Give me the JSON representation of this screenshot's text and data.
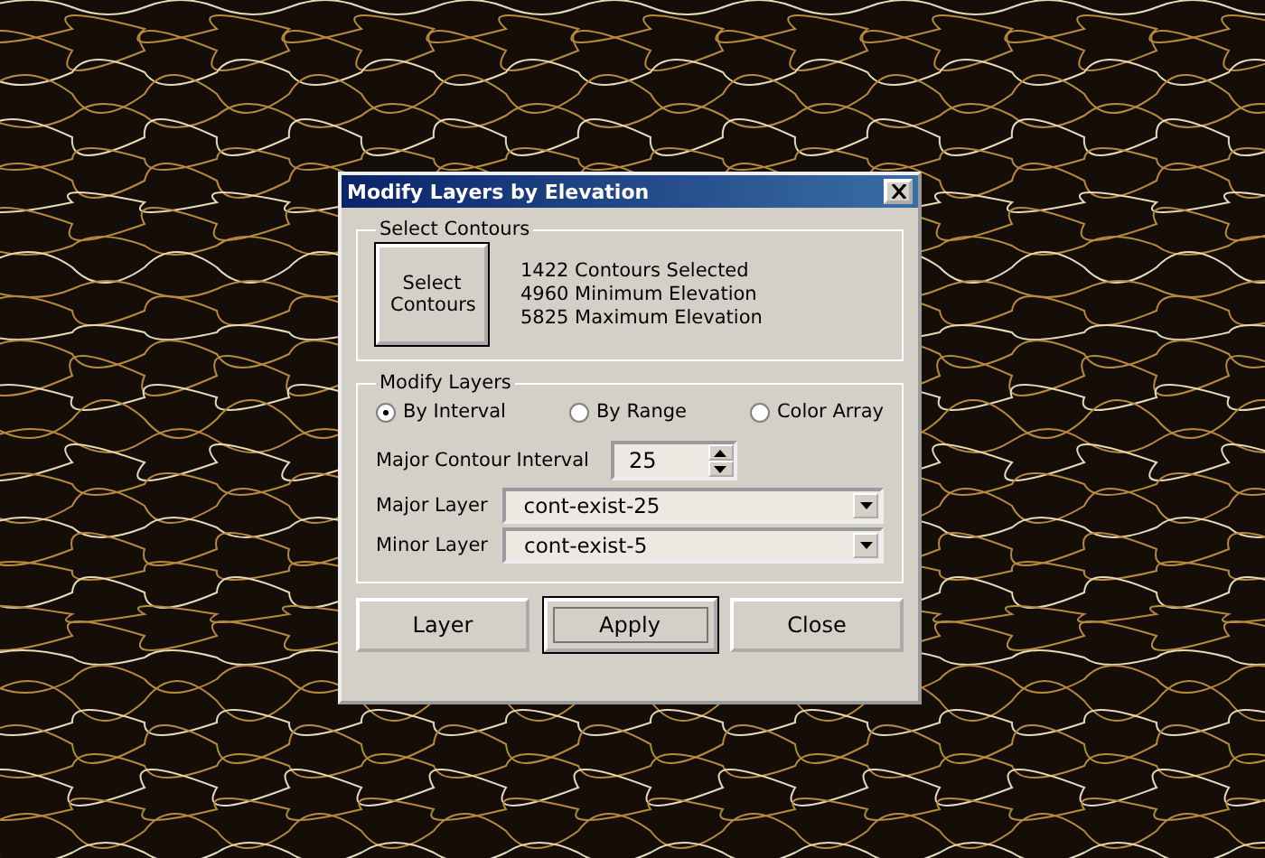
{
  "window": {
    "title": "Modify Layers by Elevation"
  },
  "select_contours": {
    "legend": "Select Contours",
    "button": "Select Contours",
    "info": [
      "1422 Contours Selected",
      "4960 Minimum Elevation",
      "5825 Maximum Elevation"
    ]
  },
  "modify_layers": {
    "legend": "Modify Layers",
    "modes": [
      {
        "label": "By Interval",
        "selected": true
      },
      {
        "label": "By Range",
        "selected": false
      },
      {
        "label": "Color Array",
        "selected": false
      }
    ],
    "interval": {
      "label": "Major Contour Interval",
      "value": "25"
    },
    "layers": [
      {
        "label": "Major Layer",
        "value": "cont-exist-25"
      },
      {
        "label": "Minor Layer",
        "value": "cont-exist-5"
      }
    ]
  },
  "buttons": [
    {
      "label": "Layer",
      "default": false
    },
    {
      "label": "Apply",
      "default": true
    },
    {
      "label": "Close",
      "default": false
    }
  ]
}
